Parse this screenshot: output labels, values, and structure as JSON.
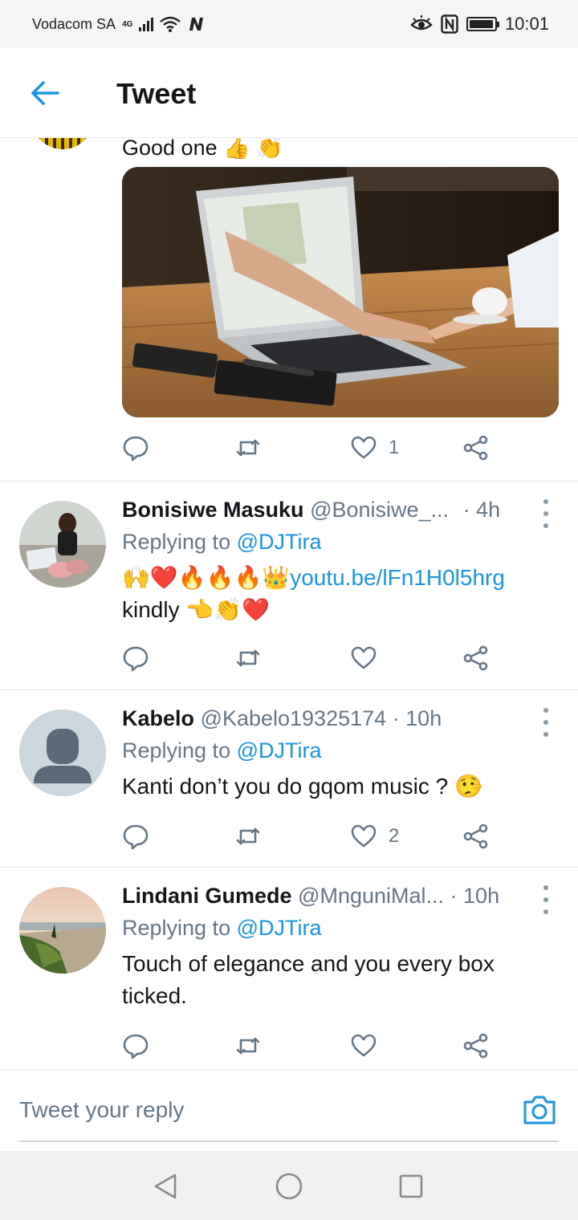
{
  "status_bar": {
    "carrier": "Vodacom SA",
    "network_type": "4G",
    "time": "10:01",
    "battery_level": 0.95
  },
  "header": {
    "title": "Tweet"
  },
  "partial_tweet": {
    "text": "Good one 👍 👏",
    "like_count": "1"
  },
  "replies": [
    {
      "name": "Bonisiwe Masuku",
      "handle": "@Bonisiwe_...",
      "time": "· 4h",
      "replying_label": "Replying to",
      "replying_to": "@DJTira",
      "emoji_prefix": "🙌❤️🔥🔥🔥👑",
      "link": "youtu.be/lFn1H0l5hrg",
      "text_line2": "kindly 👈👏❤️",
      "like_count": ""
    },
    {
      "name": "Kabelo",
      "handle": "@Kabelo19325174",
      "time": "· 10h",
      "replying_label": "Replying to",
      "replying_to": "@DJTira",
      "text": "Kanti don’t you do gqom music ? 🤥",
      "like_count": "2"
    },
    {
      "name": "Lindani Gumede",
      "handle": "@MnguniMal...",
      "time": "· 10h",
      "replying_label": "Replying to",
      "replying_to": "@DJTira",
      "text": "Touch of elegance and you every box ticked.",
      "like_count": ""
    }
  ],
  "composer": {
    "placeholder": "Tweet your reply"
  },
  "colors": {
    "accent": "#1b95e0",
    "secondary_text": "#657786",
    "primary_text": "#14171a"
  }
}
